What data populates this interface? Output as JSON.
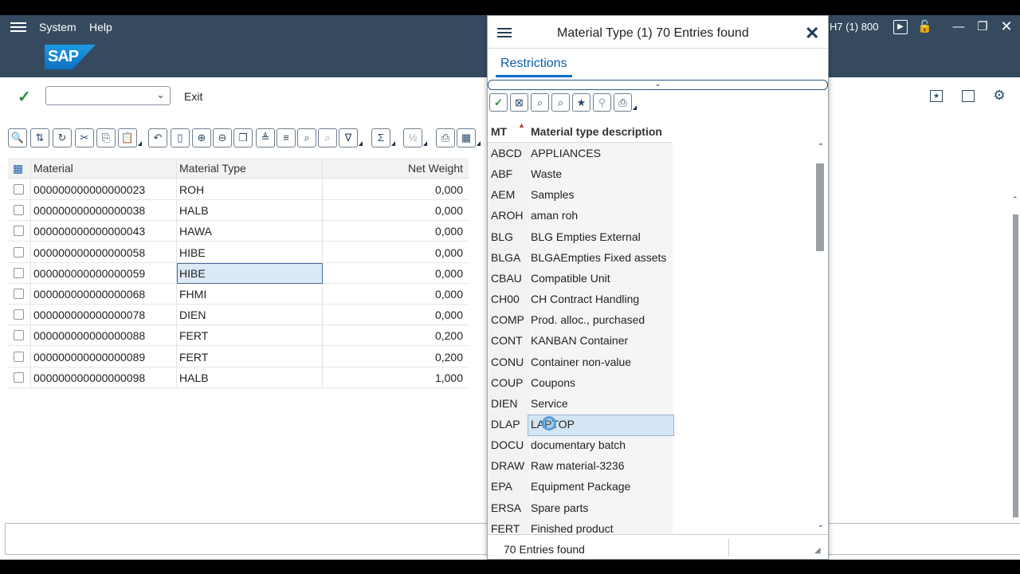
{
  "menubar": {
    "system": "System",
    "help": "Help",
    "sysinfo": "H7 (1) 800"
  },
  "logo": "SAP",
  "toolbar": {
    "exit": "Exit",
    "command_value": ""
  },
  "grid": {
    "headers": [
      "Material",
      "Material Type",
      "Net Weight"
    ],
    "rows": [
      [
        "000000000000000023",
        "ROH",
        "0,000"
      ],
      [
        "000000000000000038",
        "HALB",
        "0,000"
      ],
      [
        "000000000000000043",
        "HAWA",
        "0,000"
      ],
      [
        "000000000000000058",
        "HIBE",
        "0,000"
      ],
      [
        "000000000000000059",
        "HIBE",
        "0,000"
      ],
      [
        "000000000000000068",
        "FHMI",
        "0,000"
      ],
      [
        "000000000000000078",
        "DIEN",
        "0,000"
      ],
      [
        "000000000000000088",
        "FERT",
        "0,200"
      ],
      [
        "000000000000000089",
        "FERT",
        "0,200"
      ],
      [
        "000000000000000098",
        "HALB",
        "1,000"
      ]
    ],
    "selected_row": 4
  },
  "popup": {
    "title": "Material Type (1)   70 Entries found",
    "tab": "Restrictions",
    "col_code": "MT",
    "col_desc": "Material type description",
    "items": [
      [
        "ABCD",
        "APPLIANCES"
      ],
      [
        "ABF",
        "Waste"
      ],
      [
        "AEM",
        "Samples"
      ],
      [
        "AROH",
        "aman roh"
      ],
      [
        "BLG",
        "BLG Empties  External"
      ],
      [
        "BLGA",
        "BLGAEmpties  Fixed assets"
      ],
      [
        "CBAU",
        "Compatible Unit"
      ],
      [
        "CH00",
        "CH Contract Handling"
      ],
      [
        "COMP",
        "Prod. alloc., purchased"
      ],
      [
        "CONT",
        "KANBAN Container"
      ],
      [
        "CONU",
        "Container non-value"
      ],
      [
        "COUP",
        "Coupons"
      ],
      [
        "DIEN",
        "Service"
      ],
      [
        "DLAP",
        "LAPTOP"
      ],
      [
        "DOCU",
        "documentary batch"
      ],
      [
        "DRAW",
        "Raw material-3236"
      ],
      [
        "EPA",
        "Equipment Package"
      ],
      [
        "ERSA",
        "Spare parts"
      ],
      [
        "FERT",
        "Finished product"
      ]
    ],
    "highlighted_index": 13,
    "status": "70 Entries found"
  },
  "icons": {
    "alv_toolbar": [
      "details-icon",
      "sort-icon",
      "refresh-icon",
      "cut-icon",
      "copy-icon",
      "paste-icon",
      "undo-icon",
      "new-row-icon",
      "insert-row-icon",
      "delete-row-icon",
      "duplicate-row-icon",
      "sort-asc-icon",
      "sort-desc-icon",
      "find-icon",
      "find-next-icon",
      "filter-icon",
      "sum-icon",
      "subtotal-icon",
      "print-icon",
      "export-icon"
    ],
    "popup_toolbar": [
      "confirm-icon",
      "cancel-icon",
      "find-icon",
      "find-next-icon",
      "favorites-icon",
      "personal-list-icon",
      "print-icon"
    ]
  }
}
